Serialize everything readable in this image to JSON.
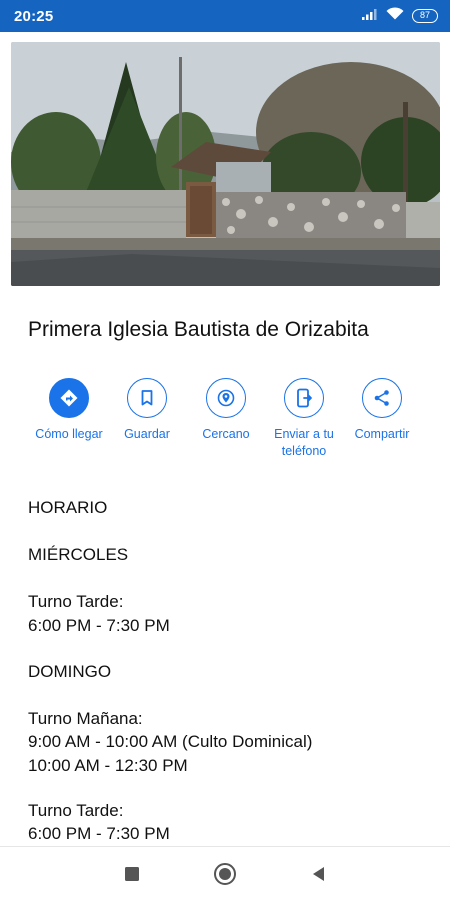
{
  "status_bar": {
    "time": "20:25",
    "battery": "87",
    "icons": [
      "signal-icon",
      "wifi-icon",
      "battery-icon"
    ]
  },
  "place": {
    "photo": "street-view-photo",
    "title": "Primera Iglesia Bautista de Orizabita"
  },
  "actions": [
    {
      "label": "Cómo llegar",
      "icon": "directions-icon",
      "primary": true
    },
    {
      "label": "Guardar",
      "icon": "bookmark-icon"
    },
    {
      "label": "Cercano",
      "icon": "nearby-icon"
    },
    {
      "label_line1": "Enviar a tu",
      "label_line2": "teléfono",
      "icon": "send-to-phone-icon"
    },
    {
      "label": "Compartir",
      "icon": "share-icon"
    }
  ],
  "schedule": {
    "heading": "HORARIO",
    "wednesday": {
      "day": "MIÉRCOLES",
      "shift_label": "Turno Tarde:",
      "time": "6:00 PM - 7:30 PM"
    },
    "sunday": {
      "day": "DOMINGO",
      "morning_label": "Turno Mañana:",
      "morning_time_1": "9:00 AM - 10:00 AM (Culto Dominical)",
      "morning_time_2": "10:00 AM - 12:30 PM",
      "afternoon_label": "Turno Tarde:",
      "afternoon_time": "6:00 PM - 7:30 PM"
    }
  },
  "nav_bar": {
    "buttons": [
      "recents-icon",
      "home-icon",
      "back-icon"
    ]
  },
  "colors": {
    "status_bar": "#1565c0",
    "accent": "#1a73e8"
  }
}
